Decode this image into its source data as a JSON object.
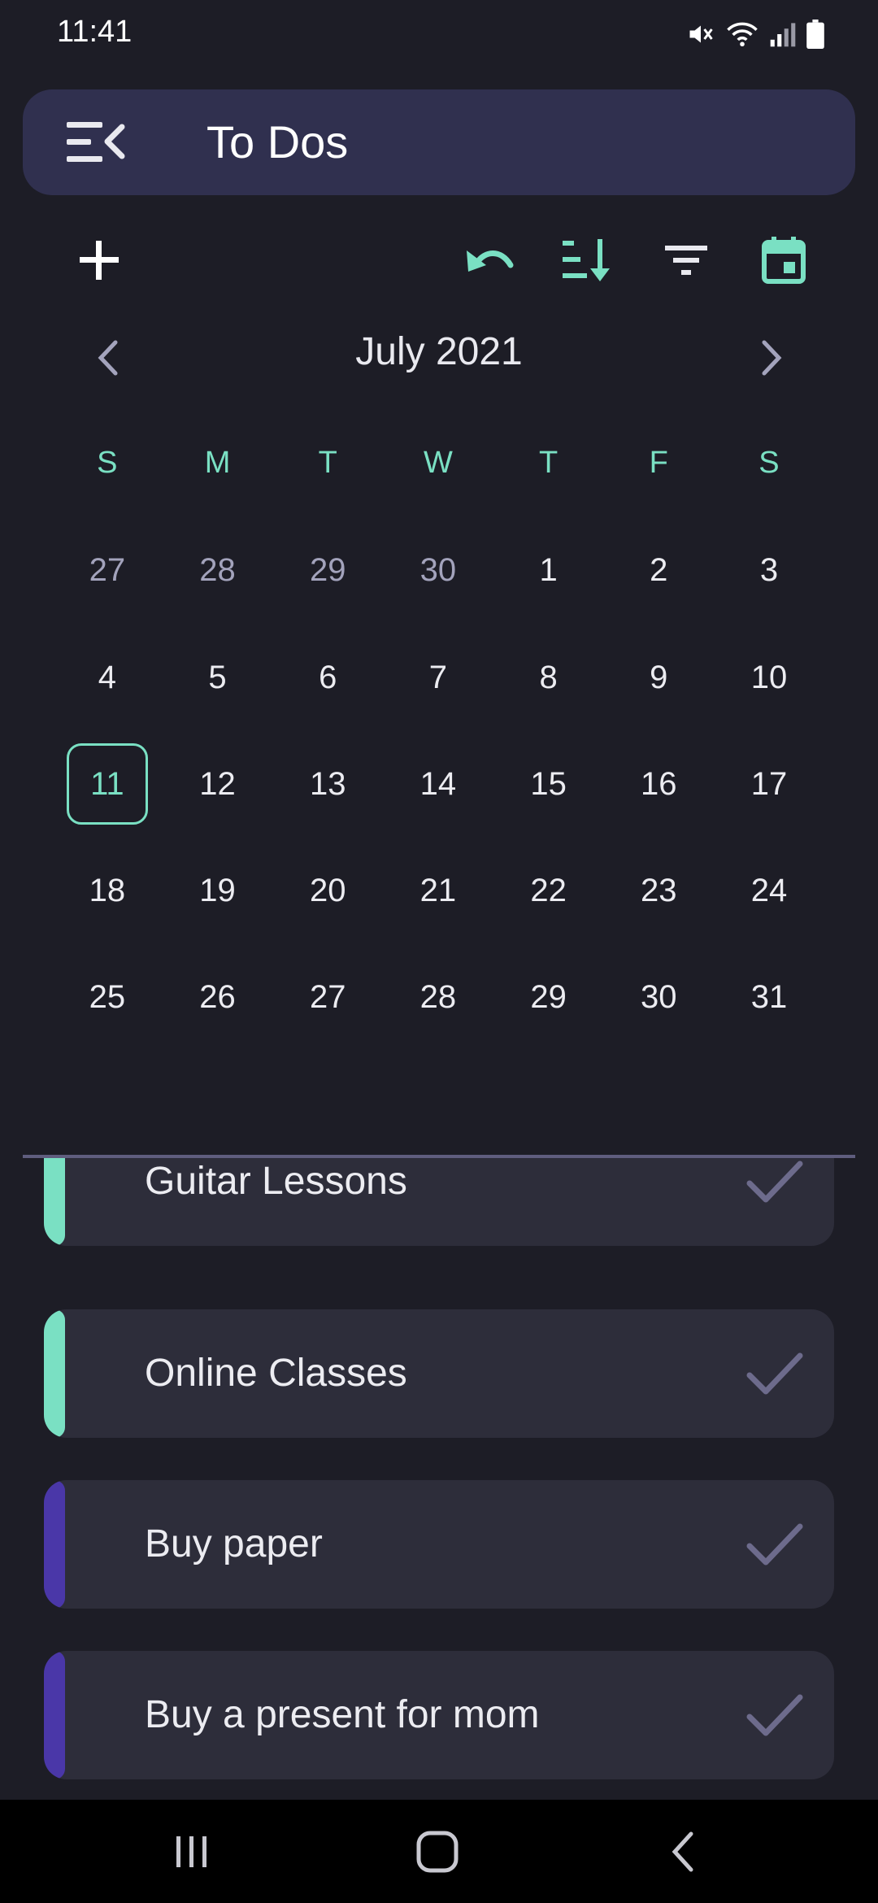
{
  "status_bar": {
    "time": "11:41",
    "icons": [
      "mute-icon",
      "wifi-icon",
      "signal-icon",
      "battery-icon"
    ]
  },
  "app_bar": {
    "title": "To Dos",
    "menu_icon": "menu-collapse-icon"
  },
  "toolbar": {
    "icons": [
      "add-icon",
      "undo-icon",
      "sort-icon",
      "filter-icon",
      "calendar-icon"
    ]
  },
  "calendar": {
    "month_label": "July 2021",
    "weekdays": [
      "S",
      "M",
      "T",
      "W",
      "T",
      "F",
      "S"
    ],
    "weeks": [
      [
        "27",
        "28",
        "29",
        "30",
        "1",
        "2",
        "3"
      ],
      [
        "4",
        "5",
        "6",
        "7",
        "8",
        "9",
        "10"
      ],
      [
        "11",
        "12",
        "13",
        "14",
        "15",
        "16",
        "17"
      ],
      [
        "18",
        "19",
        "20",
        "21",
        "22",
        "23",
        "24"
      ],
      [
        "25",
        "26",
        "27",
        "28",
        "29",
        "30",
        "31"
      ]
    ],
    "selected_day": "11"
  },
  "tasks": [
    {
      "label": "Guitar Lessons",
      "color": "#7ae0c3"
    },
    {
      "label": "Online Classes",
      "color": "#7ae0c3"
    },
    {
      "label": "Buy paper",
      "color": "#4a37a8"
    },
    {
      "label": "Buy a present for mom",
      "color": "#4a37a8"
    }
  ],
  "colors": {
    "accent": "#7ae0c3",
    "background": "#1d1d26",
    "app_bar": "#30304f",
    "card": "#2d2d3a",
    "check": "#6d6b8c"
  }
}
